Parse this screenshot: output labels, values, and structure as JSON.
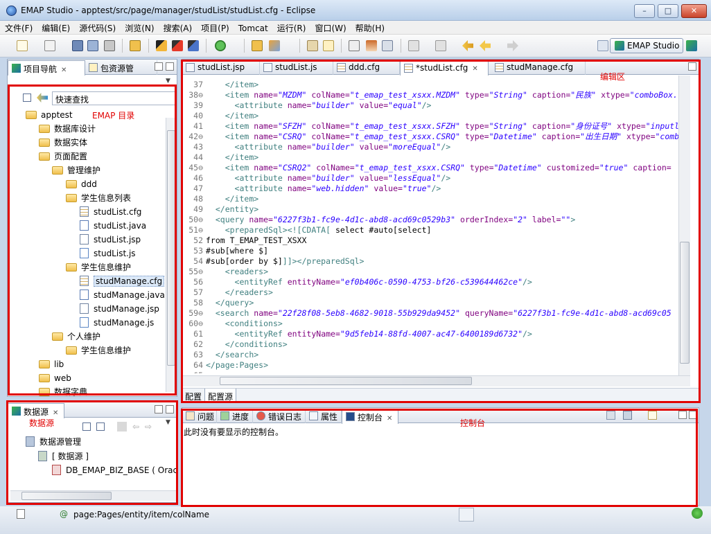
{
  "window": {
    "title": "EMAP Studio  -  apptest/src/page/manager/studList/studList.cfg  -  Eclipse",
    "min": "–",
    "max": "□",
    "close": "✕"
  },
  "menu": [
    "文件(F)",
    "编辑(E)",
    "源代码(S)",
    "浏览(N)",
    "搜索(A)",
    "项目(P)",
    "Tomcat",
    "运行(R)",
    "窗口(W)",
    "帮助(H)"
  ],
  "perspective": {
    "label": "EMAP Studio"
  },
  "left_panel": {
    "tabs": [
      "项目导航",
      "包资源管"
    ],
    "search_label": "快速查找",
    "annotation": "EMAP 目录",
    "tree": [
      {
        "label": "apptest",
        "type": "folder",
        "level": 0
      },
      {
        "label": "数据库设计",
        "type": "folder",
        "level": 1
      },
      {
        "label": "数据实体",
        "type": "folder",
        "level": 1
      },
      {
        "label": "页面配置",
        "type": "folder",
        "level": 1
      },
      {
        "label": "管理维护",
        "type": "folder",
        "level": 2
      },
      {
        "label": "ddd",
        "type": "folder",
        "level": 3
      },
      {
        "label": "学生信息列表",
        "type": "folder",
        "level": 3
      },
      {
        "label": "studList.cfg",
        "type": "cfg",
        "level": 4
      },
      {
        "label": "studList.java",
        "type": "java",
        "level": 4
      },
      {
        "label": "studList.jsp",
        "type": "jsp",
        "level": 4
      },
      {
        "label": "studList.js",
        "type": "js",
        "level": 4
      },
      {
        "label": "学生信息维护",
        "type": "folder",
        "level": 3
      },
      {
        "label": "studManage.cfg",
        "type": "cfg",
        "level": 4,
        "selected": true
      },
      {
        "label": "studManage.java",
        "type": "java",
        "level": 4
      },
      {
        "label": "studManage.jsp",
        "type": "jsp",
        "level": 4
      },
      {
        "label": "studManage.js",
        "type": "js",
        "level": 4
      },
      {
        "label": "个人维护",
        "type": "folder",
        "level": 2
      },
      {
        "label": "学生信息维护",
        "type": "folder",
        "level": 3
      },
      {
        "label": "lib",
        "type": "folder",
        "level": 1
      },
      {
        "label": "web",
        "type": "folder",
        "level": 1
      },
      {
        "label": "数据字典",
        "type": "folder",
        "level": 1
      }
    ]
  },
  "datasource_panel": {
    "tab": "数据源",
    "annotation": "数据源",
    "tree": [
      {
        "label": "数据源管理",
        "level": 0
      },
      {
        "label": "[ 数据源 ]",
        "level": 1
      },
      {
        "label": "DB_EMAP_BIZ_BASE ( Orac",
        "level": 2
      }
    ]
  },
  "editor": {
    "tabs": [
      "studList.jsp",
      "studList.js",
      "ddd.cfg",
      "*studList.cfg",
      "studManage.cfg"
    ],
    "annotation": "编辑区",
    "bottom_tabs": [
      "配置",
      "配置源"
    ],
    "lines": [
      {
        "n": "37",
        "html": "    <span class=tag>&lt;/item&gt;</span>"
      },
      {
        "n": "38⊖",
        "html": "    <span class=tag>&lt;item</span> <span class=an>name=</span><span class=av>\"MZDM\"</span> <span class=an>colName=</span><span class=av>\"t_emap_test_xsxx.MZDM\"</span> <span class=an>type=</span><span class=av>\"String\"</span> <span class=an>caption=</span><span class=av>\"民族\"</span> <span class=an>xtype=</span><span class=av>\"comboBox.</span>"
      },
      {
        "n": "39",
        "html": "      <span class=tag>&lt;attribute</span> <span class=an>name=</span><span class=av>\"builder\"</span> <span class=an>value=</span><span class=av>\"equal\"</span><span class=tag>/&gt;</span>"
      },
      {
        "n": "40",
        "html": "    <span class=tag>&lt;/item&gt;</span>"
      },
      {
        "n": "41",
        "html": "    <span class=tag>&lt;item</span> <span class=an>name=</span><span class=av>\"SFZH\"</span> <span class=an>colName=</span><span class=av>\"t_emap_test_xsxx.SFZH\"</span> <span class=an>type=</span><span class=av>\"String\"</span> <span class=an>caption=</span><span class=av>\"身份证号\"</span> <span class=an>xtype=</span><span class=av>\"inputl</span>"
      },
      {
        "n": "42⊖",
        "html": "    <span class=tag>&lt;item</span> <span class=an>name=</span><span class=av>\"CSRQ\"</span> <span class=an>colName=</span><span class=av>\"t_emap_test_xsxx.CSRQ\"</span> <span class=an>type=</span><span class=av>\"Datetime\"</span> <span class=an>caption=</span><span class=av>\"出生日期\"</span> <span class=an>xtype=</span><span class=av>\"comb</span>"
      },
      {
        "n": "43",
        "html": "      <span class=tag>&lt;attribute</span> <span class=an>name=</span><span class=av>\"builder\"</span> <span class=an>value=</span><span class=av>\"moreEqual\"</span><span class=tag>/&gt;</span>"
      },
      {
        "n": "44",
        "html": "    <span class=tag>&lt;/item&gt;</span>"
      },
      {
        "n": "45⊖",
        "html": "    <span class=tag>&lt;item</span> <span class=an>name=</span><span class=av>\"CSRQ2\"</span> <span class=an>colName=</span><span class=av>\"t_emap_test_xsxx.CSRQ\"</span> <span class=an>type=</span><span class=av>\"Datetime\"</span> <span class=an>customized=</span><span class=av>\"true\"</span> <span class=an>caption=</span>"
      },
      {
        "n": "46",
        "html": "      <span class=tag>&lt;attribute</span> <span class=an>name=</span><span class=av>\"builder\"</span> <span class=an>value=</span><span class=av>\"lessEqual\"</span><span class=tag>/&gt;</span>"
      },
      {
        "n": "47",
        "html": "      <span class=tag>&lt;attribute</span> <span class=an>name=</span><span class=av>\"web.hidden\"</span> <span class=an>value=</span><span class=av>\"true\"</span><span class=tag>/&gt;</span>"
      },
      {
        "n": "48",
        "html": "    <span class=tag>&lt;/item&gt;</span>"
      },
      {
        "n": "49",
        "html": "  <span class=tag>&lt;/entity&gt;</span>"
      },
      {
        "n": "50⊖",
        "html": "  <span class=tag>&lt;query</span> <span class=an>name=</span><span class=av>\"6227f3b1-fc9e-4d1c-abd8-acd69c0529b3\"</span> <span class=an>orderIndex=</span><span class=av>\"2\"</span> <span class=an>label=</span><span class=av>\"\"</span><span class=tag>&gt;</span>"
      },
      {
        "n": "51⊖",
        "html": "    <span class=tag>&lt;preparedSql&gt;&lt;![CDATA[</span> select #auto[select]"
      },
      {
        "n": "52",
        "html": "from T_EMAP_TEST_XSXX"
      },
      {
        "n": "53",
        "html": "#sub[where $]"
      },
      {
        "n": "54",
        "html": "#sub[order by $]<span class=tag>]]&gt;&lt;/preparedSql&gt;</span>"
      },
      {
        "n": "55⊖",
        "html": "    <span class=tag>&lt;readers&gt;</span>"
      },
      {
        "n": "56",
        "html": "      <span class=tag>&lt;entityRef</span> <span class=an>entityName=</span><span class=av>\"ef0b406c-0590-4753-bf26-c539644462ce\"</span><span class=tag>/&gt;</span>"
      },
      {
        "n": "57",
        "html": "    <span class=tag>&lt;/readers&gt;</span>"
      },
      {
        "n": "58",
        "html": "  <span class=tag>&lt;/query&gt;</span>"
      },
      {
        "n": "59⊖",
        "html": "  <span class=tag>&lt;search</span> <span class=an>name=</span><span class=av>\"22f28f08-5eb8-4682-9018-55b929da9452\"</span> <span class=an>queryName=</span><span class=av>\"6227f3b1-fc9e-4d1c-abd8-acd69c05</span>"
      },
      {
        "n": "60⊖",
        "html": "    <span class=tag>&lt;conditions&gt;</span>"
      },
      {
        "n": "61",
        "html": "      <span class=tag>&lt;entityRef</span> <span class=an>entityName=</span><span class=av>\"9d5feb14-88fd-4007-ac47-6400189d6732\"</span><span class=tag>/&gt;</span>"
      },
      {
        "n": "62",
        "html": "    <span class=tag>&lt;/conditions&gt;</span>"
      },
      {
        "n": "63",
        "html": "  <span class=tag>&lt;/search&gt;</span>"
      },
      {
        "n": "64",
        "html": "<span class=tag>&lt;/page:Pages&gt;</span>"
      },
      {
        "n": "65",
        "html": ""
      }
    ]
  },
  "console_panel": {
    "tabs": [
      "问题",
      "进度",
      "错误日志",
      "属性",
      "控制台"
    ],
    "annotation": "控制台",
    "message": "此时没有要显示的控制台。"
  },
  "status": {
    "path": "page:Pages/entity/item/colName"
  }
}
